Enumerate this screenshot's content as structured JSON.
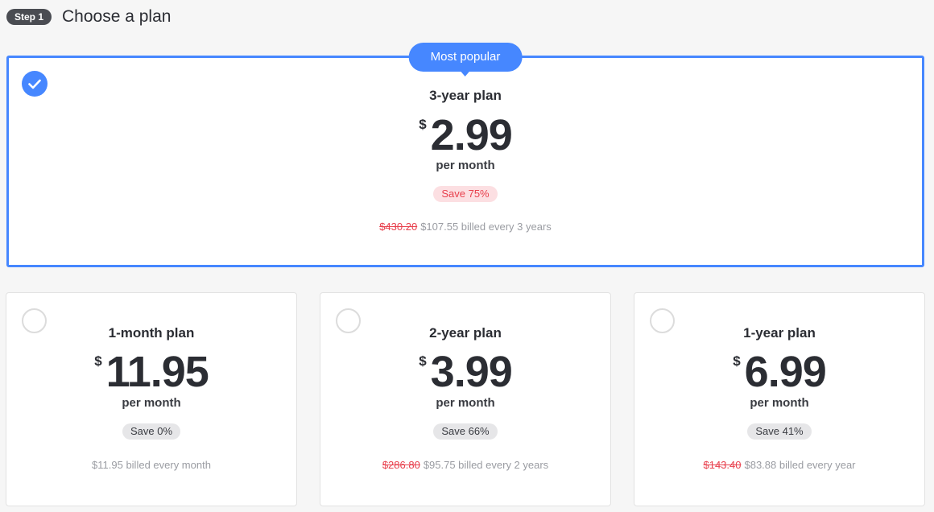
{
  "step": {
    "badge": "Step 1",
    "title": "Choose a plan"
  },
  "featured": {
    "badge": "Most popular",
    "name": "3-year plan",
    "currency": "$",
    "price": "2.99",
    "per": "per month",
    "save": "Save 75%",
    "old_price": "$430.20",
    "billing": "$107.55 billed every 3 years",
    "selected": true
  },
  "plans": [
    {
      "name": "1-month plan",
      "currency": "$",
      "price": "11.95",
      "per": "per month",
      "save": "Save 0%",
      "old_price": "",
      "billing": "$11.95 billed every month"
    },
    {
      "name": "2-year plan",
      "currency": "$",
      "price": "3.99",
      "per": "per month",
      "save": "Save 66%",
      "old_price": "$286.80",
      "billing": "$95.75 billed every 2 years"
    },
    {
      "name": "1-year plan",
      "currency": "$",
      "price": "6.99",
      "per": "per month",
      "save": "Save 41%",
      "old_price": "$143.40",
      "billing": "$83.88 billed every year"
    }
  ],
  "colors": {
    "accent": "#4687ff",
    "save_red": "#e8414e"
  },
  "icons": {
    "selected": "check-icon"
  }
}
